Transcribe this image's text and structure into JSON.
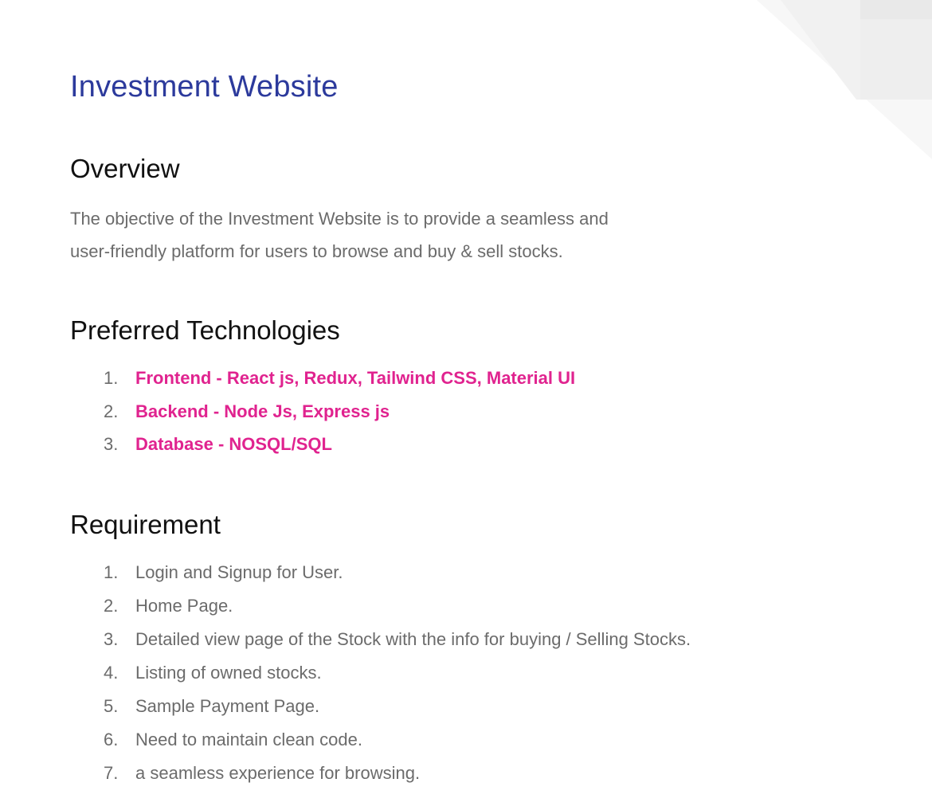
{
  "title": "Investment Website",
  "overview": {
    "heading": "Overview",
    "lines": [
      "The objective of the Investment Website is to provide a seamless and",
      "user-friendly platform for users to browse and buy & sell stocks."
    ]
  },
  "technologies": {
    "heading": "Preferred Technologies",
    "items": [
      {
        "num": "1.",
        "text": "Frontend  -  React js, Redux, Tailwind CSS, Material UI"
      },
      {
        "num": "2.",
        "text": "Backend - Node Js, Express js"
      },
      {
        "num": "3.",
        "text": "Database - NOSQL/SQL"
      }
    ]
  },
  "requirement": {
    "heading": "Requirement",
    "items": [
      {
        "num": "1.",
        "text": "Login and Signup for User."
      },
      {
        "num": "2.",
        "text": "Home Page."
      },
      {
        "num": "3.",
        "text": "Detailed view page of the Stock with the info for buying / Selling Stocks."
      },
      {
        "num": "4.",
        "text": "Listing of owned stocks."
      },
      {
        "num": "5.",
        "text": "Sample Payment Page."
      },
      {
        "num": "6.",
        "text": "Need to maintain clean code."
      },
      {
        "num": "7.",
        "text": "a seamless experience for browsing."
      }
    ]
  },
  "colors": {
    "title": "#2c3a9c",
    "heading": "#111111",
    "body_text": "#6b6b6b",
    "tech_accent": "#e0238f",
    "decor_light": "#f6f6f6",
    "decor_mid": "#eeeeee"
  }
}
